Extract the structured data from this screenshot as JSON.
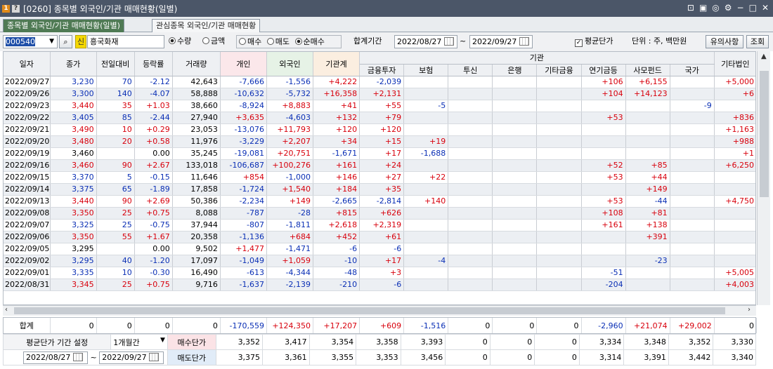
{
  "window": {
    "badge1": "1",
    "badge2": "?",
    "title": "[0260] 종목별 외국인/기관 매매현황(일별)"
  },
  "tabs": [
    "종목별 외국인/기관 매매현황(일별)",
    "관심종목 외국인/기관 매매현황"
  ],
  "toolbar": {
    "code": "000540",
    "credit_badge": "신",
    "stock_name": "흥국화재",
    "opt_qty": "수량",
    "opt_amt": "금액",
    "opt_buy": "매수",
    "opt_sell": "매도",
    "opt_net": "순매수",
    "period_label": "합계기간",
    "date_from": "2022/08/27",
    "tilde": "~",
    "date_to": "2022/09/27",
    "avg_label": "평균단가",
    "unit_label": "단위 : 주, 백만원",
    "notice_btn": "유의사항",
    "search_btn": "조회"
  },
  "columns": {
    "date": "일자",
    "close": "종가",
    "change": "전일대비",
    "rate": "등락률",
    "volume": "거래량",
    "indiv": "개인",
    "foreign": "외국인",
    "inst_total": "기관계",
    "inst": "기관",
    "fin": "금융투자",
    "ins": "보험",
    "trust": "투신",
    "bank": "은행",
    "otherfin": "기타금융",
    "pension": "연기금등",
    "pef": "사모펀드",
    "nation": "국가",
    "othercorp": "기타법인"
  },
  "rows": [
    [
      "2022/09/27",
      "3,230",
      "70",
      "-2.12",
      "42,643",
      "-7,666",
      "-1,556",
      "+4,222",
      "-2,039",
      "",
      "",
      "",
      "",
      "+106",
      "+6,155",
      "",
      "+5,000"
    ],
    [
      "2022/09/26",
      "3,300",
      "140",
      "-4.07",
      "58,888",
      "-10,632",
      "-5,732",
      "+16,358",
      "+2,131",
      "",
      "",
      "",
      "",
      "+104",
      "+14,123",
      "",
      "+6"
    ],
    [
      "2022/09/23",
      "3,440",
      "35",
      "+1.03",
      "38,660",
      "-8,924",
      "+8,883",
      "+41",
      "+55",
      "-5",
      "",
      "",
      "",
      "",
      "",
      "-9",
      ""
    ],
    [
      "2022/09/22",
      "3,405",
      "85",
      "-2.44",
      "27,940",
      "+3,635",
      "-4,603",
      "+132",
      "+79",
      "",
      "",
      "",
      "",
      "+53",
      "",
      "",
      "+836"
    ],
    [
      "2022/09/21",
      "3,490",
      "10",
      "+0.29",
      "23,053",
      "-13,076",
      "+11,793",
      "+120",
      "+120",
      "",
      "",
      "",
      "",
      "",
      "",
      "",
      "+1,163"
    ],
    [
      "2022/09/20",
      "3,480",
      "20",
      "+0.58",
      "11,976",
      "-3,229",
      "+2,207",
      "+34",
      "+15",
      "+19",
      "",
      "",
      "",
      "",
      "",
      "",
      "+988"
    ],
    [
      "2022/09/19",
      "3,460",
      "",
      "0.00",
      "35,245",
      "-19,081",
      "+20,751",
      "-1,671",
      "+17",
      "-1,688",
      "",
      "",
      "",
      "",
      "",
      "",
      "+1"
    ],
    [
      "2022/09/16",
      "3,460",
      "90",
      "+2.67",
      "133,018",
      "-106,687",
      "+100,276",
      "+161",
      "+24",
      "",
      "",
      "",
      "",
      "+52",
      "+85",
      "",
      "+6,250"
    ],
    [
      "2022/09/15",
      "3,370",
      "5",
      "-0.15",
      "11,646",
      "+854",
      "-1,000",
      "+146",
      "+27",
      "+22",
      "",
      "",
      "",
      "+53",
      "+44",
      "",
      ""
    ],
    [
      "2022/09/14",
      "3,375",
      "65",
      "-1.89",
      "17,858",
      "-1,724",
      "+1,540",
      "+184",
      "+35",
      "",
      "",
      "",
      "",
      "",
      "+149",
      "",
      ""
    ],
    [
      "2022/09/13",
      "3,440",
      "90",
      "+2.69",
      "50,386",
      "-2,234",
      "+149",
      "-2,665",
      "-2,814",
      "+140",
      "",
      "",
      "",
      "+53",
      "-44",
      "",
      "+4,750"
    ],
    [
      "2022/09/08",
      "3,350",
      "25",
      "+0.75",
      "8,088",
      "-787",
      "-28",
      "+815",
      "+626",
      "",
      "",
      "",
      "",
      "+108",
      "+81",
      "",
      ""
    ],
    [
      "2022/09/07",
      "3,325",
      "25",
      "-0.75",
      "37,944",
      "-807",
      "-1,811",
      "+2,618",
      "+2,319",
      "",
      "",
      "",
      "",
      "+161",
      "+138",
      "",
      ""
    ],
    [
      "2022/09/06",
      "3,350",
      "55",
      "+1.67",
      "20,358",
      "-1,136",
      "+684",
      "+452",
      "+61",
      "",
      "",
      "",
      "",
      "",
      "+391",
      "",
      ""
    ],
    [
      "2022/09/05",
      "3,295",
      "",
      "0.00",
      "9,502",
      "+1,477",
      "-1,471",
      "-6",
      "-6",
      "",
      "",
      "",
      "",
      "",
      "",
      "",
      ""
    ],
    [
      "2022/09/02",
      "3,295",
      "40",
      "-1.20",
      "17,097",
      "-1,049",
      "+1,059",
      "-10",
      "+17",
      "-4",
      "",
      "",
      "",
      "",
      "-23",
      "",
      ""
    ],
    [
      "2022/09/01",
      "3,335",
      "10",
      "-0.30",
      "16,490",
      "-613",
      "-4,344",
      "-48",
      "+3",
      "",
      "",
      "",
      "",
      "-51",
      "",
      "",
      "+5,005"
    ],
    [
      "2022/08/31",
      "3,345",
      "25",
      "+0.75",
      "9,716",
      "-1,637",
      "-2,139",
      "-210",
      "-6",
      "",
      "",
      "",
      "",
      "-204",
      "",
      "",
      "+4,003"
    ]
  ],
  "row_colors": [
    "b",
    "b",
    "r",
    "b",
    "r",
    "r",
    "",
    "r",
    "b",
    "b",
    "r",
    "r",
    "b",
    "r",
    "",
    "b",
    "b",
    "r"
  ],
  "totals": {
    "label": "합계",
    "values": [
      "0",
      "0",
      "0",
      "0",
      "-170,559",
      "+124,350",
      "+17,207",
      "+609",
      "-1,516",
      "0",
      "0",
      "0",
      "-2,960",
      "+21,074",
      "+29,002",
      "0"
    ]
  },
  "bottom": {
    "avg_period_label": "평균단가 기간 설정",
    "period_select": "1개월간",
    "date_from": "2022/08/27",
    "tilde": "~",
    "date_to": "2022/09/27",
    "buy_label": "매수단가",
    "sell_label": "매도단가",
    "buy_values": [
      "3,352",
      "3,417",
      "3,354",
      "3,358",
      "3,393",
      "0",
      "0",
      "0",
      "3,334",
      "3,348",
      "3,352",
      "3,330"
    ],
    "sell_values": [
      "3,375",
      "3,361",
      "3,355",
      "3,353",
      "3,456",
      "0",
      "0",
      "0",
      "3,314",
      "3,391",
      "3,442",
      "3,340"
    ]
  },
  "colors": {
    "title_bg": "#4b5668",
    "active_tab": "#4f7a54",
    "positive": "#d8000c",
    "negative": "#0a2fb5"
  }
}
